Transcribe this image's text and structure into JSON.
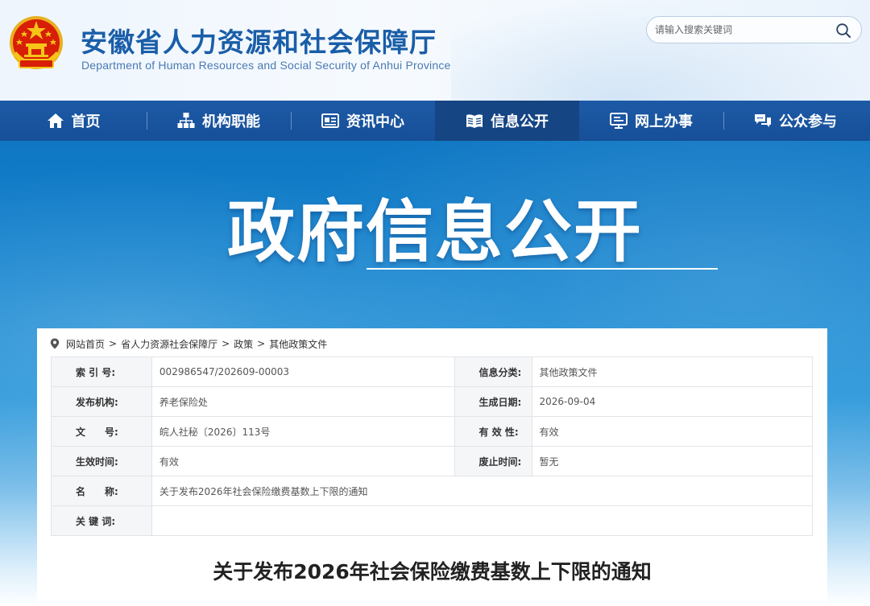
{
  "header": {
    "title": "安徽省人力资源和社会保障厅",
    "subtitle": "Department of Human Resources and Social Security of Anhui Province",
    "search_placeholder": "请输入搜索关键词",
    "emblem_icon": "national-emblem-icon"
  },
  "nav": {
    "items": [
      {
        "label": "首页",
        "icon": "home-icon"
      },
      {
        "label": "机构职能",
        "icon": "org-chart-icon"
      },
      {
        "label": "资讯中心",
        "icon": "news-icon"
      },
      {
        "label": "信息公开",
        "icon": "open-book-icon",
        "active": true
      },
      {
        "label": "网上办事",
        "icon": "monitor-icon"
      },
      {
        "label": "公众参与",
        "icon": "chat-bubbles-icon"
      }
    ]
  },
  "banner": {
    "title": "政府信息公开"
  },
  "breadcrumb": {
    "items": [
      "网站首页",
      "省人力资源社会保障厅",
      "政策",
      "其他政策文件"
    ],
    "separator": ">"
  },
  "info": {
    "index_label": "索 引 号:",
    "index_value": "002986547/202609-00003",
    "category_label": "信息分类:",
    "category_value": "其他政策文件",
    "publisher_label": "发布机构:",
    "publisher_value": "养老保险处",
    "created_label": "生成日期:",
    "created_value": "2026-09-04",
    "docno_label": "文　　号:",
    "docno_value": "皖人社秘〔2026〕113号",
    "validity_label": "有 效 性:",
    "validity_value": "有效",
    "effective_label": "生效时间:",
    "effective_value": "有效",
    "expiry_label": "废止时间:",
    "expiry_value": "暂无",
    "name_label": "名　　称:",
    "name_value": "关于发布2026年社会保险缴费基数上下限的通知",
    "keywords_label": "关 键 词:",
    "keywords_value": ""
  },
  "document": {
    "title": "关于发布2026年社会保险缴费基数上下限的通知"
  },
  "colors": {
    "brand_blue": "#1a5ea8",
    "nav_bg": "#1d5aa6",
    "nav_active": "#154583",
    "emblem_red": "#d81e06",
    "emblem_gold": "#f5c518"
  }
}
